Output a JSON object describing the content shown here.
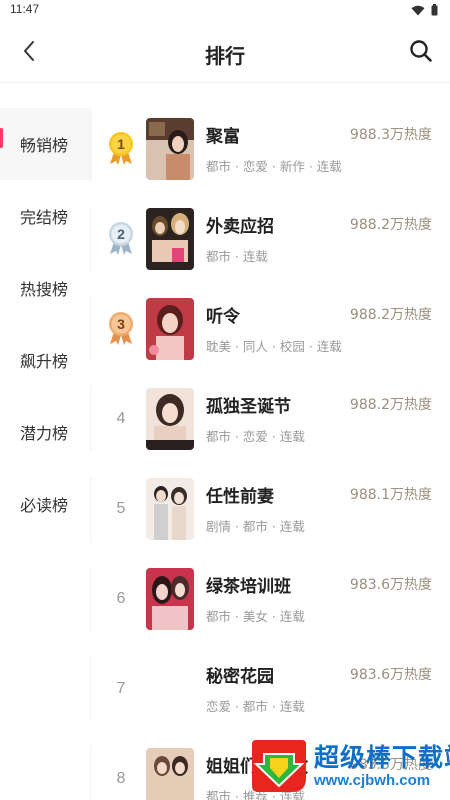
{
  "status_bar": {
    "time": "11:47"
  },
  "header": {
    "title": "排行",
    "back_icon": "chevron-left-icon",
    "search_icon": "search-icon"
  },
  "sidebar": {
    "items": [
      {
        "label": "畅销榜",
        "active": true
      },
      {
        "label": "完结榜",
        "active": false
      },
      {
        "label": "热搜榜",
        "active": false
      },
      {
        "label": "飙升榜",
        "active": false
      },
      {
        "label": "潜力榜",
        "active": false
      },
      {
        "label": "必读榜",
        "active": false
      }
    ]
  },
  "ranking": [
    {
      "rank": "1",
      "medal": "gold",
      "title": "聚富",
      "heat": "988.3万热度",
      "tags": "都市 · 恋爱 · 新作 · 连载",
      "cover_colors": [
        "#6b4a3a",
        "#d9b9a3"
      ]
    },
    {
      "rank": "2",
      "medal": "silver",
      "title": "外卖应招",
      "heat": "988.2万热度",
      "tags": "都市 · 连载",
      "cover_colors": [
        "#3a2b2b",
        "#e8c9b6"
      ]
    },
    {
      "rank": "3",
      "medal": "bronze",
      "title": "听令",
      "heat": "988.2万热度",
      "tags": "耽美 · 同人 · 校园 · 连载",
      "cover_colors": [
        "#b3343e",
        "#f2c6c2"
      ]
    },
    {
      "rank": "4",
      "medal": "",
      "title": "孤独圣诞节",
      "heat": "988.2万热度",
      "tags": "都市 · 恋爱 · 连载",
      "cover_colors": [
        "#5a4a4a",
        "#efd9cf"
      ]
    },
    {
      "rank": "5",
      "medal": "",
      "title": "任性前妻",
      "heat": "988.1万热度",
      "tags": "剧情 · 都市 · 连载",
      "cover_colors": [
        "#8a8a8a",
        "#f4ece6"
      ]
    },
    {
      "rank": "6",
      "medal": "",
      "title": "绿茶培训班",
      "heat": "983.6万热度",
      "tags": "都市 · 美女 · 连载",
      "cover_colors": [
        "#c0304a",
        "#f1c4c8"
      ]
    },
    {
      "rank": "7",
      "medal": "",
      "title": "秘密花园",
      "heat": "983.6万热度",
      "tags": "恋爱 · 都市 · 连载",
      "cover_colors": null
    },
    {
      "rank": "8",
      "medal": "",
      "title": "姐姐们的调教",
      "heat": "983.5万热度",
      "tags": "都市 · 推荐 · 连载",
      "cover_colors": [
        "#7a5a4a",
        "#e6cdb8"
      ]
    }
  ],
  "watermark": {
    "text": "超级棒下载站",
    "url": "www.cjbwh.com"
  },
  "colors": {
    "accent": "#ff3b6b",
    "heat": "#9c8f7e",
    "gold": "#f2b400",
    "silver": "#aebfd0",
    "bronze": "#f0a86a"
  }
}
